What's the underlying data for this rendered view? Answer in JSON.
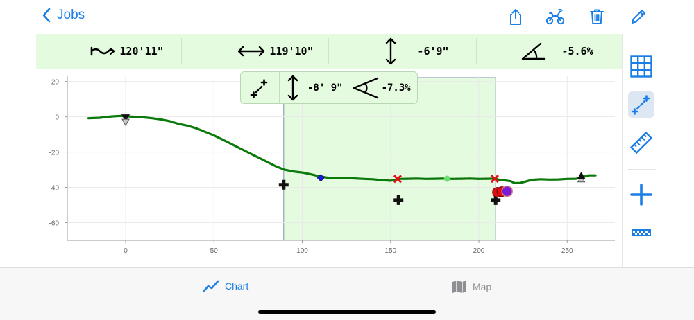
{
  "nav": {
    "back_label": "Jobs"
  },
  "toolbar_icons": [
    "share-icon",
    "dirt-bike-icon",
    "trash-icon",
    "pencil-icon"
  ],
  "stats": {
    "path_length": "120'11\"",
    "horizontal_distance": "119'10\"",
    "vertical_change": "-6'9\"",
    "slope": "-5.6%"
  },
  "segment": {
    "vertical_change": "-8' 9\"",
    "slope": "-7.3%"
  },
  "right_tools": [
    "grid-icon",
    "segment-measure-icon",
    "ruler-icon",
    "add-icon",
    "checker-strip-icon"
  ],
  "tabs": {
    "chart_label": "Chart",
    "map_label": "Map"
  },
  "colors": {
    "accent": "#1a7ee5",
    "profile": "#0b7a0b",
    "highlight": "#e4fbdf",
    "marker_red": "#e01010"
  },
  "chart_data": {
    "type": "line",
    "xlim": [
      -33,
      277
    ],
    "ylim": [
      -70,
      23
    ],
    "x_ticks": [
      0,
      50,
      100,
      150,
      200,
      250
    ],
    "y_ticks": [
      20,
      0,
      -20,
      -40,
      -60
    ],
    "selection_range": [
      89.5,
      209.5
    ],
    "series": [
      {
        "values": [
          [
            -21,
            -0.8
          ],
          [
            -15,
            -0.6
          ],
          [
            -8,
            0.2
          ],
          [
            -3,
            0.5
          ],
          [
            0,
            0.3
          ],
          [
            5,
            0
          ],
          [
            10,
            -0.3
          ],
          [
            15,
            -0.8
          ],
          [
            20,
            -1.5
          ],
          [
            25,
            -2.5
          ],
          [
            30,
            -4.0
          ],
          [
            35,
            -5.0
          ],
          [
            40,
            -6.5
          ],
          [
            45,
            -8.5
          ],
          [
            50,
            -10.5
          ],
          [
            55,
            -13
          ],
          [
            60,
            -15.5
          ],
          [
            65,
            -18
          ],
          [
            70,
            -20.5
          ],
          [
            75,
            -23
          ],
          [
            80,
            -25.5
          ],
          [
            85,
            -28
          ],
          [
            90,
            -30
          ],
          [
            95,
            -31
          ],
          [
            100,
            -31.6
          ],
          [
            105,
            -32.6
          ],
          [
            110,
            -33.8
          ],
          [
            115,
            -34.6
          ],
          [
            120,
            -34.8
          ],
          [
            125,
            -34.7
          ],
          [
            130,
            -34.9
          ],
          [
            135,
            -35.2
          ],
          [
            140,
            -35.4
          ],
          [
            145,
            -35.9
          ],
          [
            150,
            -36.2
          ],
          [
            152,
            -35.8
          ],
          [
            155,
            -35.2
          ],
          [
            160,
            -35.1
          ],
          [
            165,
            -35.0
          ],
          [
            170,
            -35.2
          ],
          [
            175,
            -35.1
          ],
          [
            180,
            -35.0
          ],
          [
            185,
            -35.2
          ],
          [
            190,
            -35.1
          ],
          [
            195,
            -35.0
          ],
          [
            200,
            -35.2
          ],
          [
            205,
            -35.1
          ],
          [
            209,
            -35.0
          ],
          [
            212,
            -35.8
          ],
          [
            216,
            -36.2
          ],
          [
            218,
            -36.5
          ],
          [
            220,
            -37.5
          ],
          [
            223,
            -37.6
          ],
          [
            226,
            -36.8
          ],
          [
            230,
            -35.7
          ],
          [
            235,
            -35.4
          ],
          [
            240,
            -35.6
          ],
          [
            245,
            -35.5
          ],
          [
            250,
            -35.2
          ],
          [
            255,
            -35.1
          ],
          [
            258,
            -34.4
          ],
          [
            262,
            -33.2
          ],
          [
            266,
            -33.2
          ]
        ]
      }
    ],
    "segment_line": [
      [
        154,
        -35.2
      ],
      [
        209,
        -35.1
      ]
    ],
    "markers": [
      {
        "kind": "triangle-down",
        "x": 0,
        "y": -1
      },
      {
        "kind": "triangle-up",
        "x": 258,
        "y": -35
      },
      {
        "kind": "cross",
        "x": 89.5,
        "y": -38.5
      },
      {
        "kind": "cross",
        "x": 154.5,
        "y": -47.2
      },
      {
        "kind": "cross",
        "x": 209.5,
        "y": -47.2
      },
      {
        "kind": "diamond",
        "x": 110.5,
        "y": -34.6
      },
      {
        "kind": "x-red",
        "x": 154,
        "y": -35.2
      },
      {
        "kind": "x-red",
        "x": 209,
        "y": -35.1
      },
      {
        "kind": "dot-green",
        "x": 182,
        "y": -35.1
      },
      {
        "kind": "dot-red",
        "x": 210.5,
        "y": -42.8
      },
      {
        "kind": "dot-red",
        "x": 213,
        "y": -42.4
      },
      {
        "kind": "dot-purple",
        "x": 216,
        "y": -42.2
      }
    ]
  }
}
